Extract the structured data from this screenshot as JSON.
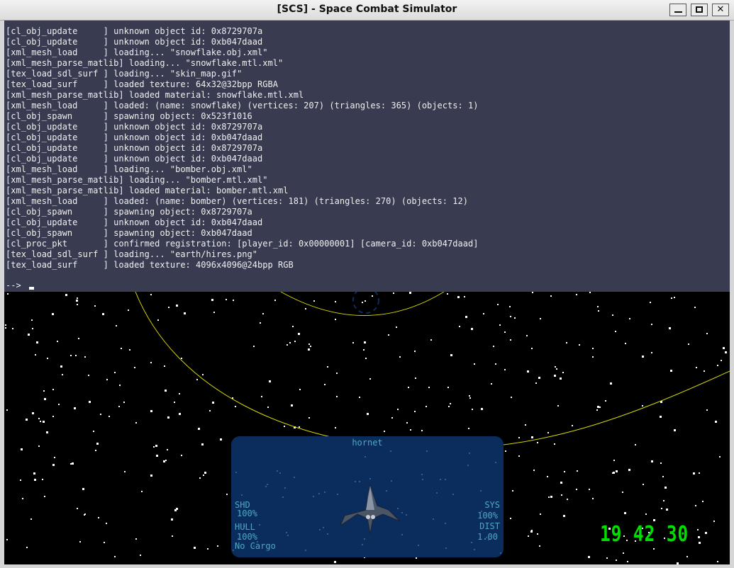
{
  "window": {
    "title": "[SCS] - Space Combat Simulator",
    "buttons": {
      "minimize": "minimize",
      "maximize": "maximize",
      "close": "close"
    }
  },
  "console": {
    "lines": [
      "[cl_obj_update     ] unknown object id: 0x8729707a",
      "[cl_obj_update     ] unknown object id: 0xb047daad",
      "[xml_mesh_load     ] loading... \"snowflake.obj.xml\"",
      "[xml_mesh_parse_matlib] loading... \"snowflake.mtl.xml\"",
      "[tex_load_sdl_surf ] loading... \"skin_map.gif\"",
      "[tex_load_surf     ] loaded texture: 64x32@32bpp RGBA",
      "[xml_mesh_parse_matlib] loaded material: snowflake.mtl.xml",
      "[xml_mesh_load     ] loaded: (name: snowflake) (vertices: 207) (triangles: 365) (objects: 1)",
      "[cl_obj_spawn      ] spawning object: 0x523f1016",
      "[cl_obj_update     ] unknown object id: 0x8729707a",
      "[cl_obj_update     ] unknown object id: 0xb047daad",
      "[cl_obj_update     ] unknown object id: 0x8729707a",
      "[cl_obj_update     ] unknown object id: 0xb047daad",
      "[xml_mesh_load     ] loading... \"bomber.obj.xml\"",
      "[xml_mesh_parse_matlib] loading... \"bomber.mtl.xml\"",
      "[xml_mesh_parse_matlib] loaded material: bomber.mtl.xml",
      "[xml_mesh_load     ] loaded: (name: bomber) (vertices: 181) (triangles: 270) (objects: 12)",
      "[cl_obj_spawn      ] spawning object: 0x8729707a",
      "[cl_obj_update     ] unknown object id: 0xb047daad",
      "[cl_obj_spawn      ] spawning object: 0xb047daad",
      "[cl_proc_pkt       ] confirmed registration: [player_id: 0x00000001] [camera_id: 0xb047daad]",
      "[tex_load_sdl_surf ] loading... \"earth/hires.png\"",
      "[tex_load_surf     ] loaded texture: 4096x4096@24bpp RGB"
    ],
    "prompt": "-->",
    "input_value": ""
  },
  "hud": {
    "target": {
      "name": "hornet",
      "shd_label": "SHD",
      "shd_value": "100%",
      "hull_label": "HULL",
      "hull_value": "100%",
      "cargo": "No Cargo",
      "sys_label": "SYS",
      "sys_value": "100%",
      "dist_label": "DIST",
      "dist_value": "1.00"
    },
    "clock": "19 42 30"
  },
  "colors": {
    "console_bg": "#393b50",
    "console_text": "#f0f0f0",
    "space_bg": "#000000",
    "orbit_line": "#d8d800",
    "hud_panel": "#0a2d5e",
    "hud_text": "#4fa7c5",
    "clock": "#00e000"
  }
}
